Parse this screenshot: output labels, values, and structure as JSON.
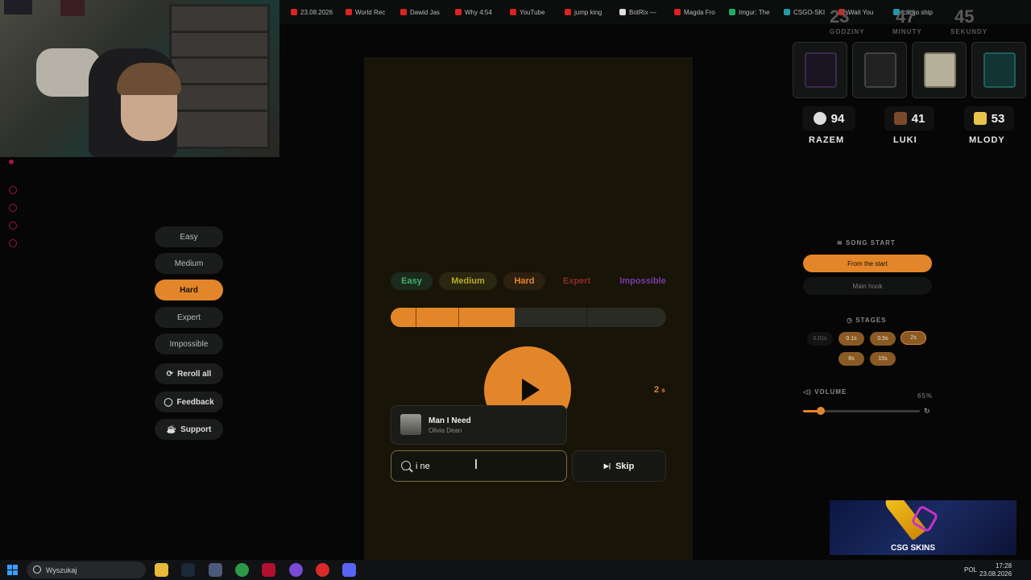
{
  "browser_tabs": [
    {
      "label": "23.08.2026",
      "icon": "red-icon"
    },
    {
      "label": "World Rec",
      "icon": "youtube-icon"
    },
    {
      "label": "Dawid Jas",
      "icon": "youtube-icon"
    },
    {
      "label": "Why 4:54",
      "icon": "youtube-icon"
    },
    {
      "label": "YouTube",
      "icon": "youtube-icon"
    },
    {
      "label": "jump king",
      "icon": "youtube-icon"
    },
    {
      "label": "BotRix —",
      "icon": "botrix-icon"
    },
    {
      "label": "Magda Fro",
      "icon": "youtube-icon"
    },
    {
      "label": "Imgur: The",
      "icon": "imgur-icon"
    },
    {
      "label": "CSGO-SKI",
      "icon": "csgo-icon"
    },
    {
      "label": "Wait You",
      "icon": "youtube-icon"
    },
    {
      "label": "cargo ship",
      "icon": "google-icon"
    }
  ],
  "countdown": {
    "hours": "23",
    "hours_label": "GODZINY",
    "minutes": "47",
    "minutes_label": "MINUTY",
    "seconds": "45",
    "seconds_label": "SEKUNDY"
  },
  "left_panel": {
    "difficulties": [
      "Easy",
      "Medium",
      "Hard",
      "Expert",
      "Impossible"
    ],
    "active": "Hard",
    "reroll": "Reroll all",
    "feedback": "Feedback",
    "support": "Support"
  },
  "game": {
    "tabs": [
      {
        "label": "Easy",
        "color": "#3fae6a"
      },
      {
        "label": "Medium",
        "color": "#b8a92c"
      },
      {
        "label": "Hard",
        "color": "#e3862a"
      },
      {
        "label": "Expert",
        "color": "#8a2b2b"
      },
      {
        "label": "Impossible",
        "color": "#7a3aa8"
      }
    ],
    "progress_fraction": 0.45,
    "stage_value": "2",
    "stage_unit": "s",
    "suggestion_title": "Man I Need",
    "suggestion_artist": "Olivia Dean",
    "search_value": "i ne",
    "skip_label": "Skip"
  },
  "scoreboard": [
    {
      "name": "RAZEM",
      "score": "94",
      "icon": "skull-icon"
    },
    {
      "name": "LUKI",
      "score": "41",
      "icon": "head-icon"
    },
    {
      "name": "MLODY",
      "score": "53",
      "icon": "sponge-icon"
    }
  ],
  "settings": {
    "song_start_label": "SONG START",
    "from_start": "From the start",
    "main_hook": "Main hook",
    "stages_label": "STAGES",
    "stages": [
      "0.01s",
      "0.1s",
      "0.5s",
      "2s",
      "8s",
      "15s"
    ],
    "active_stage": "2s",
    "volume_label": "VOLUME",
    "volume_value": "65%",
    "volume_fraction": 0.15
  },
  "ad": {
    "text": "CSG SKINS"
  },
  "taskbar": {
    "search": "Wyszukaj",
    "lang": "POL",
    "time": "17:28",
    "date": "23.08.2026"
  }
}
